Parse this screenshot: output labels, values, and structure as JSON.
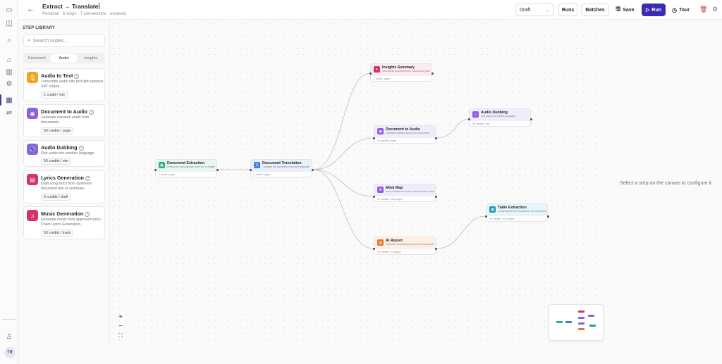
{
  "header": {
    "title": "Extract → Translate",
    "subtitle": "Personal · 6 steps · 7 connections · unsaved",
    "status_select": "Draft",
    "runs_label": "Runs",
    "batches_label": "Batches",
    "save_label": "Save",
    "run_label": "Run",
    "tour_label": "Tour"
  },
  "library": {
    "title": "STEP LIBRARY",
    "search_placeholder": "Search nodes...",
    "tabs": [
      {
        "label": "Document",
        "active": false
      },
      {
        "label": "Audio",
        "active": true
      },
      {
        "label": "Insights",
        "active": false
      }
    ],
    "cards": [
      {
        "name": "Audio to Text",
        "desc": "Transcribe audio into text with optional SRT output.",
        "badge": "1 credit / min",
        "color": "#f0a422",
        "icon": "microphone-icon"
      },
      {
        "name": "Document to Audio",
        "desc": "Generate narrated audio from documents.",
        "badge": "50 credits / page",
        "color": "#8a63e0",
        "icon": "audio-wave-icon"
      },
      {
        "name": "Audio Dubbing",
        "desc": "Dub audio into another language.",
        "badge": "50 credits / min",
        "color": "#8a63e0",
        "icon": "speaker-icon"
      },
      {
        "name": "Lyrics Generation",
        "desc": "Draft song lyrics from upstream document text or summary.",
        "badge": "5 credits / draft",
        "color": "#d8306a",
        "icon": "lyrics-icon"
      },
      {
        "name": "Music Generation",
        "desc": "Generate music from approved lyrics. Chain Lyrics Generation...",
        "badge": "50 credits / track",
        "color": "#d8306a",
        "icon": "music-note-icon"
      }
    ]
  },
  "nodes": [
    {
      "id": "doc-extraction",
      "title": "Document Extraction",
      "desc": "Extract text and structure from PDF or images (OCR).",
      "foot": "1 credit / page",
      "color": "#2fae7a",
      "head": "#e7f6ef",
      "icon": "document-extraction-icon"
    },
    {
      "id": "doc-translation",
      "title": "Document Translation",
      "desc": "Translate the document to another language.",
      "foot": "1 credit / page",
      "color": "#3d7be0",
      "head": "#e9f0fc",
      "icon": "translate-icon"
    },
    {
      "id": "insights-summary",
      "title": "Insights Summary",
      "desc": "Summarize documents into concise key points and highlights.",
      "foot": "1 credit / page",
      "color": "#d8306a",
      "head": "#fcebf1",
      "icon": "insights-icon"
    },
    {
      "id": "doc-to-audio",
      "title": "Document to Audio",
      "desc": "Generate narrated audio from documents.",
      "foot": "50 credits / page",
      "color": "#8a63e0",
      "head": "#f1ecfc",
      "icon": "audio-wave-icon"
    },
    {
      "id": "audio-dubbing",
      "title": "Audio Dubbing",
      "desc": "Dub audio into another language.",
      "foot": "50 credits / min",
      "color": "#8a63e0",
      "head": "#f1ecfc",
      "icon": "speaker-icon"
    },
    {
      "id": "mind-map",
      "title": "Mind Map",
      "desc": "Build a visual mind map from document content.",
      "foot": "10 credits / 100 pages",
      "color": "#8a63e0",
      "head": "#f1ecfc",
      "icon": "mind-map-icon"
    },
    {
      "id": "table-extraction",
      "title": "Table Extraction",
      "desc": "Extract tables from documents into structured data.",
      "foot": "10 credits / 100 pages",
      "color": "#1e9bb0",
      "head": "#e6f5f7",
      "icon": "table-icon"
    },
    {
      "id": "ai-report",
      "title": "AI Report",
      "desc": "Generate a structured AI report from document content.",
      "foot": "10 credits / 10 pages",
      "color": "#e0762a",
      "head": "#fdefe4",
      "icon": "report-icon"
    }
  ],
  "right_panel": {
    "hint": "Select a step on the canvas to configure it."
  },
  "user": {
    "initials": "TR"
  }
}
